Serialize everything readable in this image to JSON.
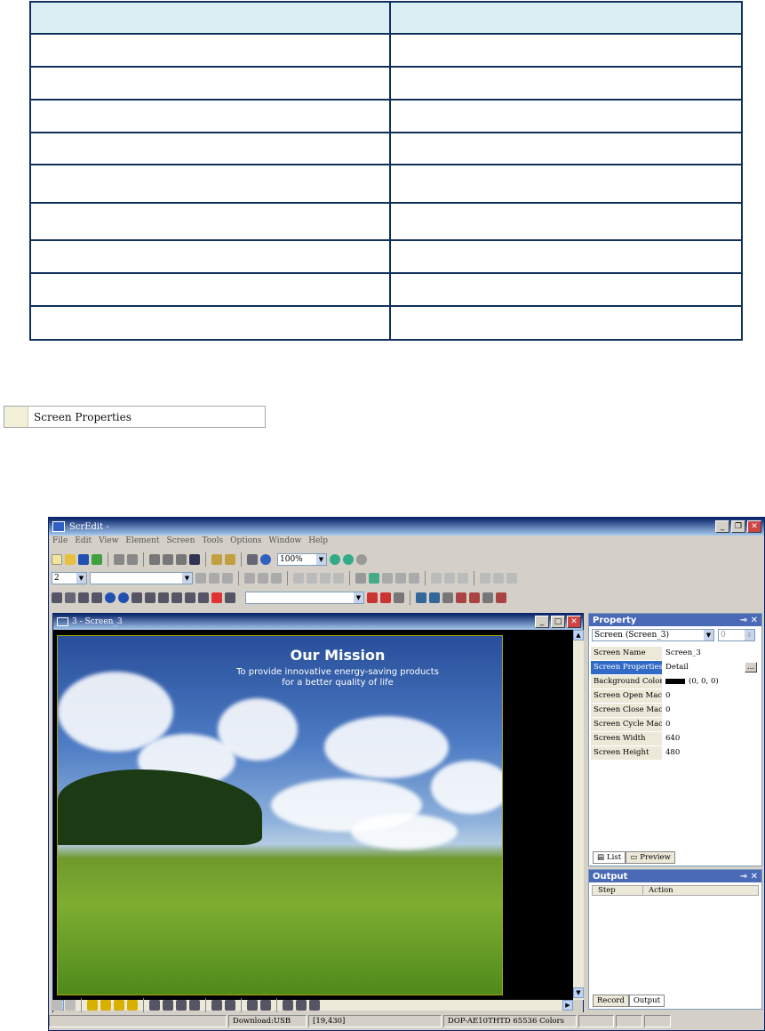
{
  "table": {
    "header": [
      "",
      ""
    ],
    "rows": 9
  },
  "label_box": {
    "text": "Screen Properties"
  },
  "window": {
    "title": "ScrEdit -",
    "menu": [
      "File",
      "Edit",
      "View",
      "Element",
      "Screen",
      "Tools",
      "Options",
      "Window",
      "Help"
    ],
    "zoom": "100%",
    "style_combo": "2",
    "child": {
      "title": "3 - Screen_3",
      "image_title": "Our Mission",
      "image_line1": "To provide innovative energy-saving products",
      "image_line2": "for a better quality of life"
    },
    "property": {
      "title": "Property",
      "selector": "Screen (Screen_3)",
      "spin": "0",
      "rows": [
        {
          "k": "Screen Name",
          "v": "Screen_3"
        },
        {
          "k": "Screen Properties",
          "v": "Detail",
          "sel": true,
          "btn": "..."
        },
        {
          "k": "Background Color",
          "v": "(0, 0, 0)",
          "swatch": "#000000"
        },
        {
          "k": "Screen Open Macro",
          "v": "0"
        },
        {
          "k": "Screen Close Macro",
          "v": "0"
        },
        {
          "k": "Screen Cycle Macro",
          "v": "0"
        },
        {
          "k": "Screen Width",
          "v": "640"
        },
        {
          "k": "Screen Height",
          "v": "480"
        }
      ],
      "tabs": [
        "List",
        "Preview"
      ]
    },
    "output": {
      "title": "Output",
      "cols": [
        "Step",
        "Action"
      ],
      "tabs": [
        "Record",
        "Output"
      ]
    },
    "status": {
      "download": "Download:USB",
      "coords": "[19,430]",
      "model": "DOP-AE10THTD 65536 Colors"
    }
  },
  "colors": {
    "table_border": "#10305a",
    "table_header": "#daeef3",
    "titlebar": "#0a246a",
    "selection": "#316ac5"
  }
}
